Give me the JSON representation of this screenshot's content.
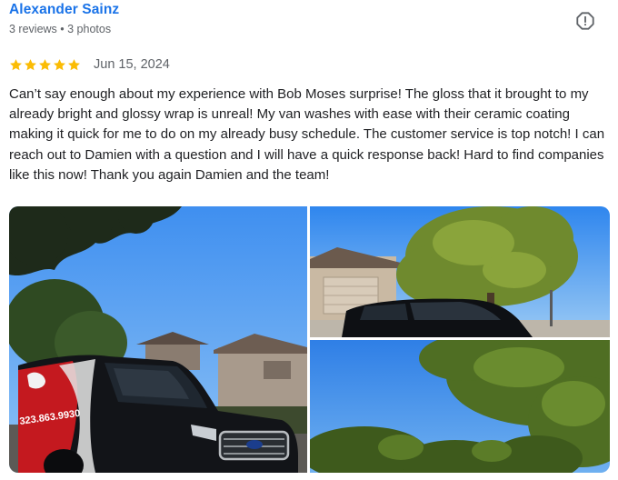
{
  "review": {
    "reviewer_name": "Alexander Sainz",
    "reviewer_meta": "3 reviews • 3 photos",
    "rating": 5,
    "star_color": "#fbbc04",
    "date": "Jun 15, 2024",
    "text": "Can’t say enough about my experience with Bob Moses surprise! The gloss that it brought to my already bright and glossy wrap is unreal! My van washes with ease with their ceramic coating making it quick for me to do on my already busy schedule. The customer service is top notch! I can reach out to Damien with a question and I will have a quick response back! Hard to find companies like this now! Thank you again Damien and the team!",
    "report_icon": "report-icon",
    "photos": [
      {
        "name": "photo-van-front",
        "van_text": "323.863.9930"
      },
      {
        "name": "photo-van-side-tree"
      },
      {
        "name": "photo-tree-sky"
      }
    ]
  },
  "colors": {
    "name_link": "#1a73e8",
    "meta_gray": "#5f6368",
    "text": "#202124"
  }
}
